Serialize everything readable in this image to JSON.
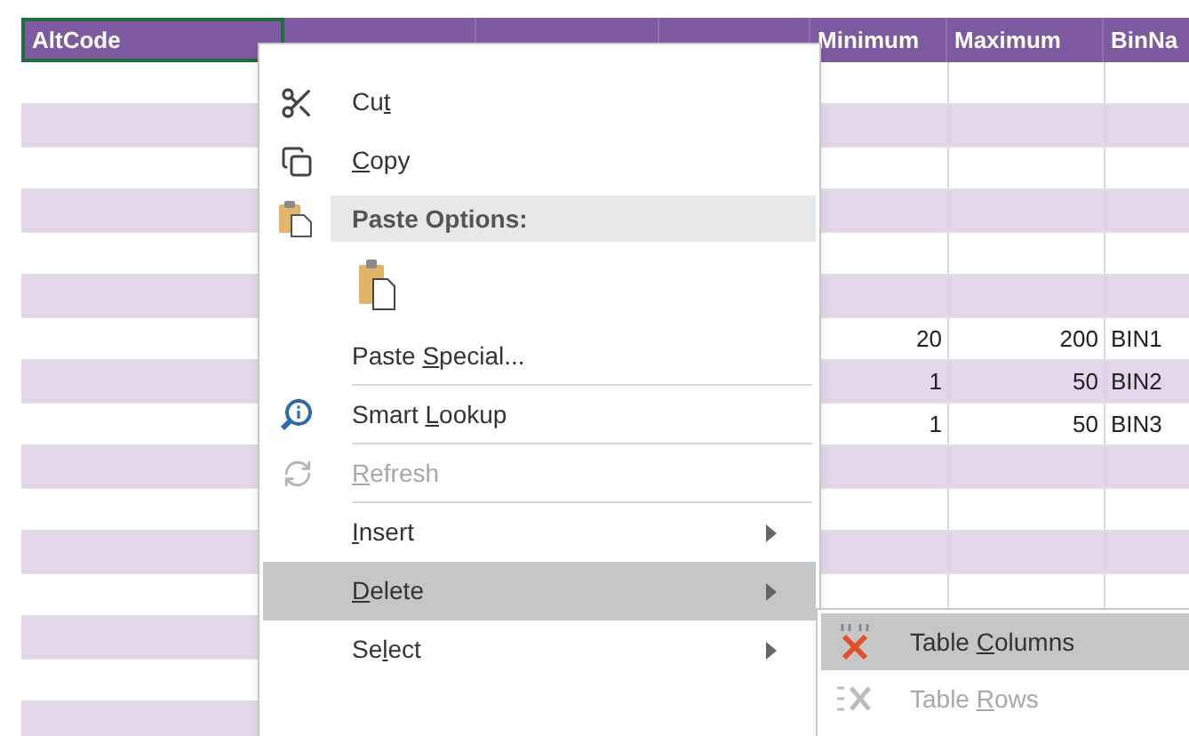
{
  "sheet": {
    "columns": [
      {
        "label": "AltCode",
        "selected": true
      },
      {
        "selected": false
      },
      {
        "selected": false
      },
      {
        "selected": false
      },
      {
        "label": "Minimum",
        "selected": false
      },
      {
        "label": "Maximum",
        "selected": false
      },
      {
        "label": "BinNa",
        "selected": false
      }
    ],
    "rows": [
      {},
      {},
      {},
      {},
      {},
      {},
      {
        "minimum": "20",
        "maximum": "200",
        "bin_name": "BIN1"
      },
      {
        "minimum": "1",
        "maximum": "50",
        "bin_name": "BIN2"
      },
      {
        "minimum": "1",
        "maximum": "50",
        "bin_name": "BIN3"
      },
      {},
      {},
      {},
      {},
      {},
      {},
      {}
    ]
  },
  "context_menu": {
    "items": [
      {
        "kind": "command",
        "text_before": "Cu",
        "key": "t",
        "disabled": false,
        "selected": false,
        "submenu": false,
        "separator_after": false
      },
      {
        "kind": "command",
        "key": "C",
        "text_after": "opy",
        "disabled": false,
        "selected": false,
        "submenu": false,
        "separator_after": false
      },
      {
        "kind": "header",
        "label": "Paste Options:"
      },
      {
        "kind": "paste_option"
      },
      {
        "kind": "command",
        "text_before": "Paste ",
        "key": "S",
        "text_after": "pecial...",
        "disabled": false,
        "selected": false,
        "submenu": false,
        "separator_after": true
      },
      {
        "kind": "command",
        "text_before": "Smart ",
        "key": "L",
        "text_after": "ookup",
        "disabled": false,
        "selected": false,
        "submenu": false,
        "separator_after": true
      },
      {
        "kind": "command",
        "key": "R",
        "text_after": "efresh",
        "disabled": true,
        "selected": false,
        "submenu": false,
        "separator_after": true
      },
      {
        "kind": "command",
        "key": "I",
        "text_after": "nsert",
        "disabled": false,
        "selected": false,
        "submenu": true,
        "separator_after": false
      },
      {
        "kind": "command",
        "key": "D",
        "text_after": "elete",
        "disabled": false,
        "selected": true,
        "submenu": true,
        "separator_after": false
      },
      {
        "kind": "command",
        "text_before": "Se",
        "key": "l",
        "text_after": "ect",
        "disabled": false,
        "selected": false,
        "submenu": true,
        "separator_after": false
      }
    ]
  },
  "submenu": {
    "items": [
      {
        "text_before": "Table ",
        "key": "C",
        "text_after": "olumns",
        "disabled": false,
        "selected": true
      },
      {
        "text_before": "Table ",
        "key": "R",
        "text_after": "ows",
        "disabled": true,
        "selected": false
      }
    ]
  }
}
